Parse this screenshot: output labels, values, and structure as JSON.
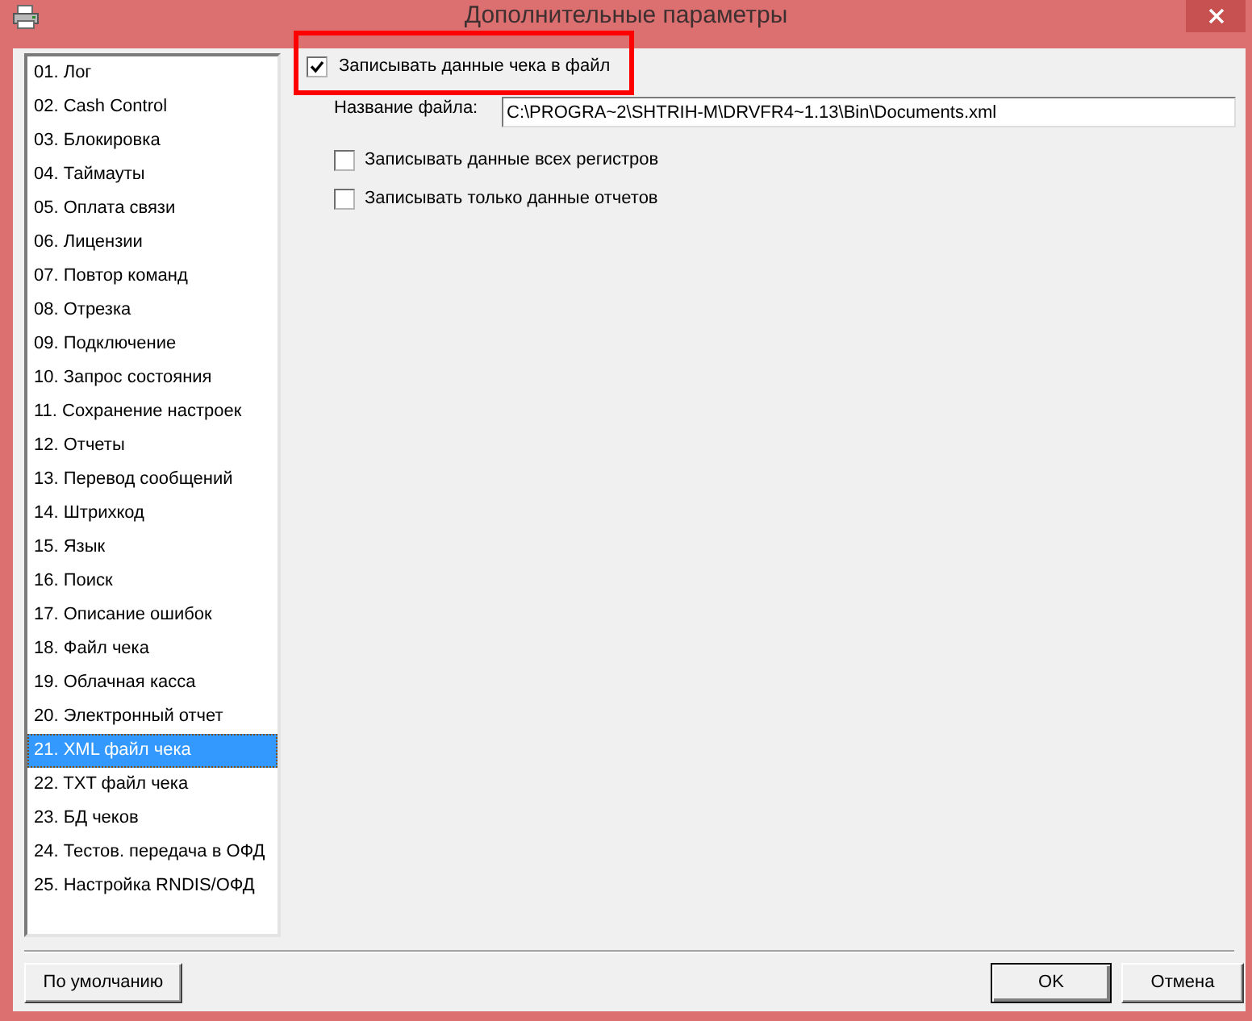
{
  "window": {
    "title": "Дополнительные параметры"
  },
  "sidebar": {
    "items": [
      {
        "label": "01. Лог",
        "selected": false
      },
      {
        "label": "02. Cash Control",
        "selected": false
      },
      {
        "label": "03. Блокировка",
        "selected": false
      },
      {
        "label": "04. Таймауты",
        "selected": false
      },
      {
        "label": "05. Оплата связи",
        "selected": false
      },
      {
        "label": "06. Лицензии",
        "selected": false
      },
      {
        "label": "07. Повтор команд",
        "selected": false
      },
      {
        "label": "08. Отрезка",
        "selected": false
      },
      {
        "label": "09. Подключение",
        "selected": false
      },
      {
        "label": "10. Запрос состояния",
        "selected": false
      },
      {
        "label": "11. Сохранение настроек",
        "selected": false
      },
      {
        "label": "12. Отчеты",
        "selected": false
      },
      {
        "label": "13. Перевод сообщений",
        "selected": false
      },
      {
        "label": "14. Штрихкод",
        "selected": false
      },
      {
        "label": "15. Язык",
        "selected": false
      },
      {
        "label": "16. Поиск",
        "selected": false
      },
      {
        "label": "17. Описание ошибок",
        "selected": false
      },
      {
        "label": "18. Файл чека",
        "selected": false
      },
      {
        "label": "19. Облачная касса",
        "selected": false
      },
      {
        "label": "20. Электронный отчет",
        "selected": false
      },
      {
        "label": "21. XML файл чека",
        "selected": true
      },
      {
        "label": "22. TXT файл чека",
        "selected": false
      },
      {
        "label": "23. БД чеков",
        "selected": false
      },
      {
        "label": "24. Тестов. передача в ОФД",
        "selected": false
      },
      {
        "label": "25. Настройка RNDIS/ОФД",
        "selected": false
      }
    ]
  },
  "panel": {
    "write_receipt": {
      "label": "Записывать данные чека в файл",
      "checked": true
    },
    "file_name": {
      "label": "Название файла:",
      "value": "C:\\PROGRA~2\\SHTRIH-M\\DRVFR4~1.13\\Bin\\Documents.xml"
    },
    "options": [
      {
        "label": "Записывать данные всех регистров",
        "checked": false
      },
      {
        "label": "Записывать только данные отчетов",
        "checked": false
      }
    ]
  },
  "footer": {
    "left_button": {
      "label": "По умолчанию"
    },
    "right_buttons": [
      {
        "label": "OK",
        "default": true
      },
      {
        "label": "Отмена",
        "default": false
      }
    ]
  }
}
